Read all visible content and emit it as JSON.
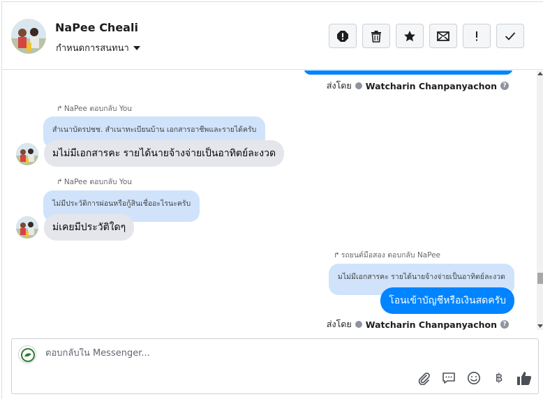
{
  "header": {
    "contact_name": "NaPee Cheali",
    "assign_label": "กำหนดการสนทนา",
    "toolbar": [
      "alert-icon",
      "trash-icon",
      "star-icon",
      "mail-icon",
      "exclamation-icon",
      "check-icon"
    ]
  },
  "messages": {
    "sent_by_prefix": "ส่งโดย",
    "agent_name": "Watcharin Chanpanyachon",
    "reply1": {
      "replied_label": "NaPee ตอบกลับ You",
      "quote": "สำเนาบัตรปชช. สำเนาทะเบียนบ้าน เอกสารอาชีพและรายได้ครับ",
      "text": "มไม่มีเอกสารคะ รายได้นายจ้างจ่ายเป็นอาทิตย์ละงวด"
    },
    "reply2": {
      "replied_label": "NaPee ตอบกลับ You",
      "quote": "ไม่มีประวัติการผ่อนหรือกู้สินเชื่ออะไรนะครับ",
      "text": "ม่เคยมีประวัติใดๆ"
    },
    "reply3": {
      "replied_label": "รถยนต์มือสอง ตอบกลับ NaPee",
      "quote": "มไม่มีเอกสารคะ รายได้นายจ้างจ่ายเป็นอาทิตย์ละงวด",
      "text": "โอนเข้าบัญชีหรือเงินสดครับ"
    }
  },
  "composer": {
    "placeholder": "ตอบกลับใน Messenger...",
    "tools": [
      "attachment-icon",
      "saved-replies-icon",
      "emoji-icon",
      "baht-icon",
      "thumbs-up-icon"
    ],
    "baht_symbol": "฿"
  },
  "colors": {
    "accent": "#0084ff",
    "quote_bg": "#d0e3fb",
    "incoming_bg": "#e4e6eb"
  }
}
